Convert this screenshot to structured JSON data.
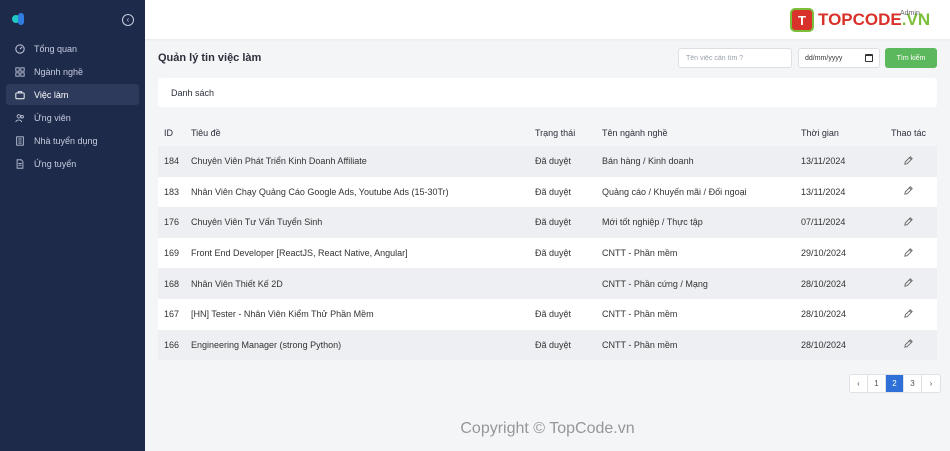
{
  "sidebar": {
    "items": [
      {
        "label": "Tổng quan",
        "icon": "dashboard-icon",
        "active": false
      },
      {
        "label": "Ngành nghề",
        "icon": "grid-icon",
        "active": false
      },
      {
        "label": "Việc làm",
        "icon": "briefcase-icon",
        "active": true
      },
      {
        "label": "Ứng viên",
        "icon": "users-icon",
        "active": false
      },
      {
        "label": "Nhà tuyển dụng",
        "icon": "building-icon",
        "active": false
      },
      {
        "label": "Ứng tuyển",
        "icon": "document-icon",
        "active": false
      }
    ]
  },
  "topbar": {
    "brand_mark": "T",
    "brand_name": "TOPCODE",
    "brand_domain": ".VN",
    "admin_label": "Admin"
  },
  "main": {
    "title": "Quản lý tin việc làm",
    "search_placeholder": "Tên việc cần tìm ?",
    "date_placeholder": "dd/mm/yyyy",
    "search_button": "Tìm kiếm",
    "card_title": "Danh sách"
  },
  "table": {
    "headers": {
      "id": "ID",
      "title": "Tiêu đề",
      "status": "Trạng thái",
      "category": "Tên ngành nghề",
      "time": "Thời gian",
      "action": "Thao tác"
    },
    "rows": [
      {
        "id": "184",
        "title": "Chuyên Viên Phát Triển Kinh Doanh Affiliate",
        "status": "Đã duyệt",
        "category": "Bán hàng / Kinh doanh",
        "time": "13/11/2024"
      },
      {
        "id": "183",
        "title": "Nhân Viên Chạy Quảng Cáo Google Ads, Youtube Ads (15-30Tr)",
        "status": "Đã duyệt",
        "category": "Quảng cáo / Khuyến mãi / Đối ngoại",
        "time": "13/11/2024"
      },
      {
        "id": "176",
        "title": "Chuyên Viên Tư Vấn Tuyển Sinh",
        "status": "Đã duyệt",
        "category": "Mới tốt nghiệp / Thực tập",
        "time": "07/11/2024"
      },
      {
        "id": "169",
        "title": "Front End Developer [ReactJS, React Native, Angular]",
        "status": "Đã duyệt",
        "category": "CNTT - Phần mềm",
        "time": "29/10/2024"
      },
      {
        "id": "168",
        "title": "Nhân Viên Thiết Kế 2D",
        "status": "",
        "category": "CNTT - Phần cứng / Mạng",
        "time": "28/10/2024"
      },
      {
        "id": "167",
        "title": "[HN] Tester - Nhân Viên Kiểm Thử Phần Mềm",
        "status": "Đã duyệt",
        "category": "CNTT - Phần mềm",
        "time": "28/10/2024"
      },
      {
        "id": "166",
        "title": "Engineering Manager (strong Python)",
        "status": "Đã duyệt",
        "category": "CNTT - Phần mềm",
        "time": "28/10/2024"
      }
    ]
  },
  "pagination": {
    "prev": "‹",
    "pages": [
      "1",
      "2",
      "3"
    ],
    "current": "2",
    "next": "›"
  },
  "footer": {
    "copyright": "Copyright © TopCode.vn"
  },
  "colors": {
    "sidebar_bg": "#1d2a4a",
    "primary_button": "#5cb85c",
    "active_page": "#2f6fd8"
  }
}
